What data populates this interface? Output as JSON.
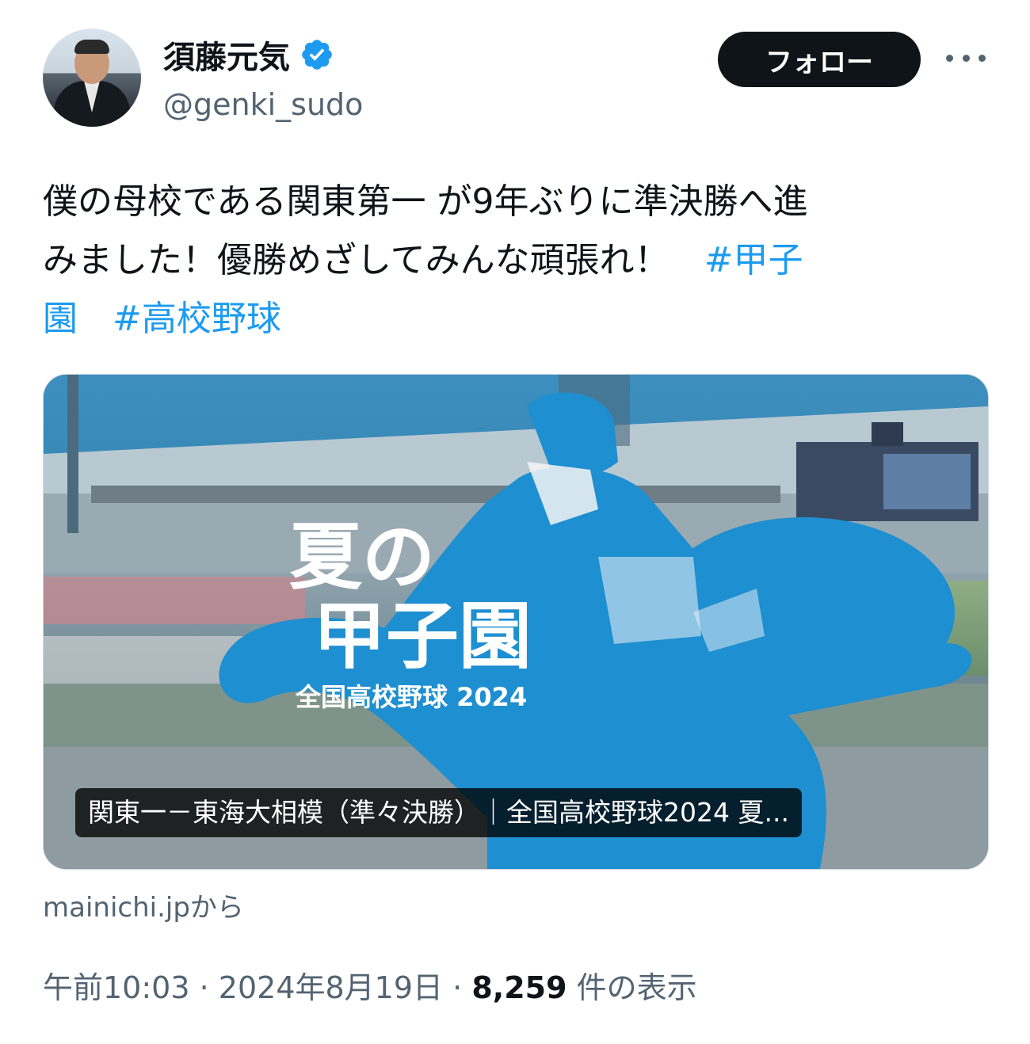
{
  "author": {
    "name": "須藤元気",
    "handle": "@genki_sudo",
    "verified": true,
    "follow_label": "フォロー"
  },
  "tweet": {
    "line1": "僕の母校である関東第一 が9年ぶりに準決勝へ進",
    "line2_text": "みました！優勝めざしてみんな頑張れ！　",
    "line2_tag": "#甲子",
    "line3_tag_end": "園",
    "line3_tag2": "#高校野球"
  },
  "card": {
    "title_line1": "夏の",
    "title_line2": "甲子園",
    "subtitle": "全国高校野球 2024",
    "caption": "関東一－東海大相模（準々決勝）｜全国高校野球2024 夏...",
    "source": "mainichi.jpから"
  },
  "meta": {
    "time": "午前10:03",
    "date": "2024年8月19日",
    "views_count": "8,259",
    "views_label": "件の表示",
    "separator": "·"
  },
  "colors": {
    "accent": "#1d9bf0",
    "follow_bg": "#0f1419",
    "secondary_text": "#536471",
    "card_blue": "#1e8fd0"
  },
  "icons": [
    "verified-badge-icon",
    "more-options-icon"
  ]
}
